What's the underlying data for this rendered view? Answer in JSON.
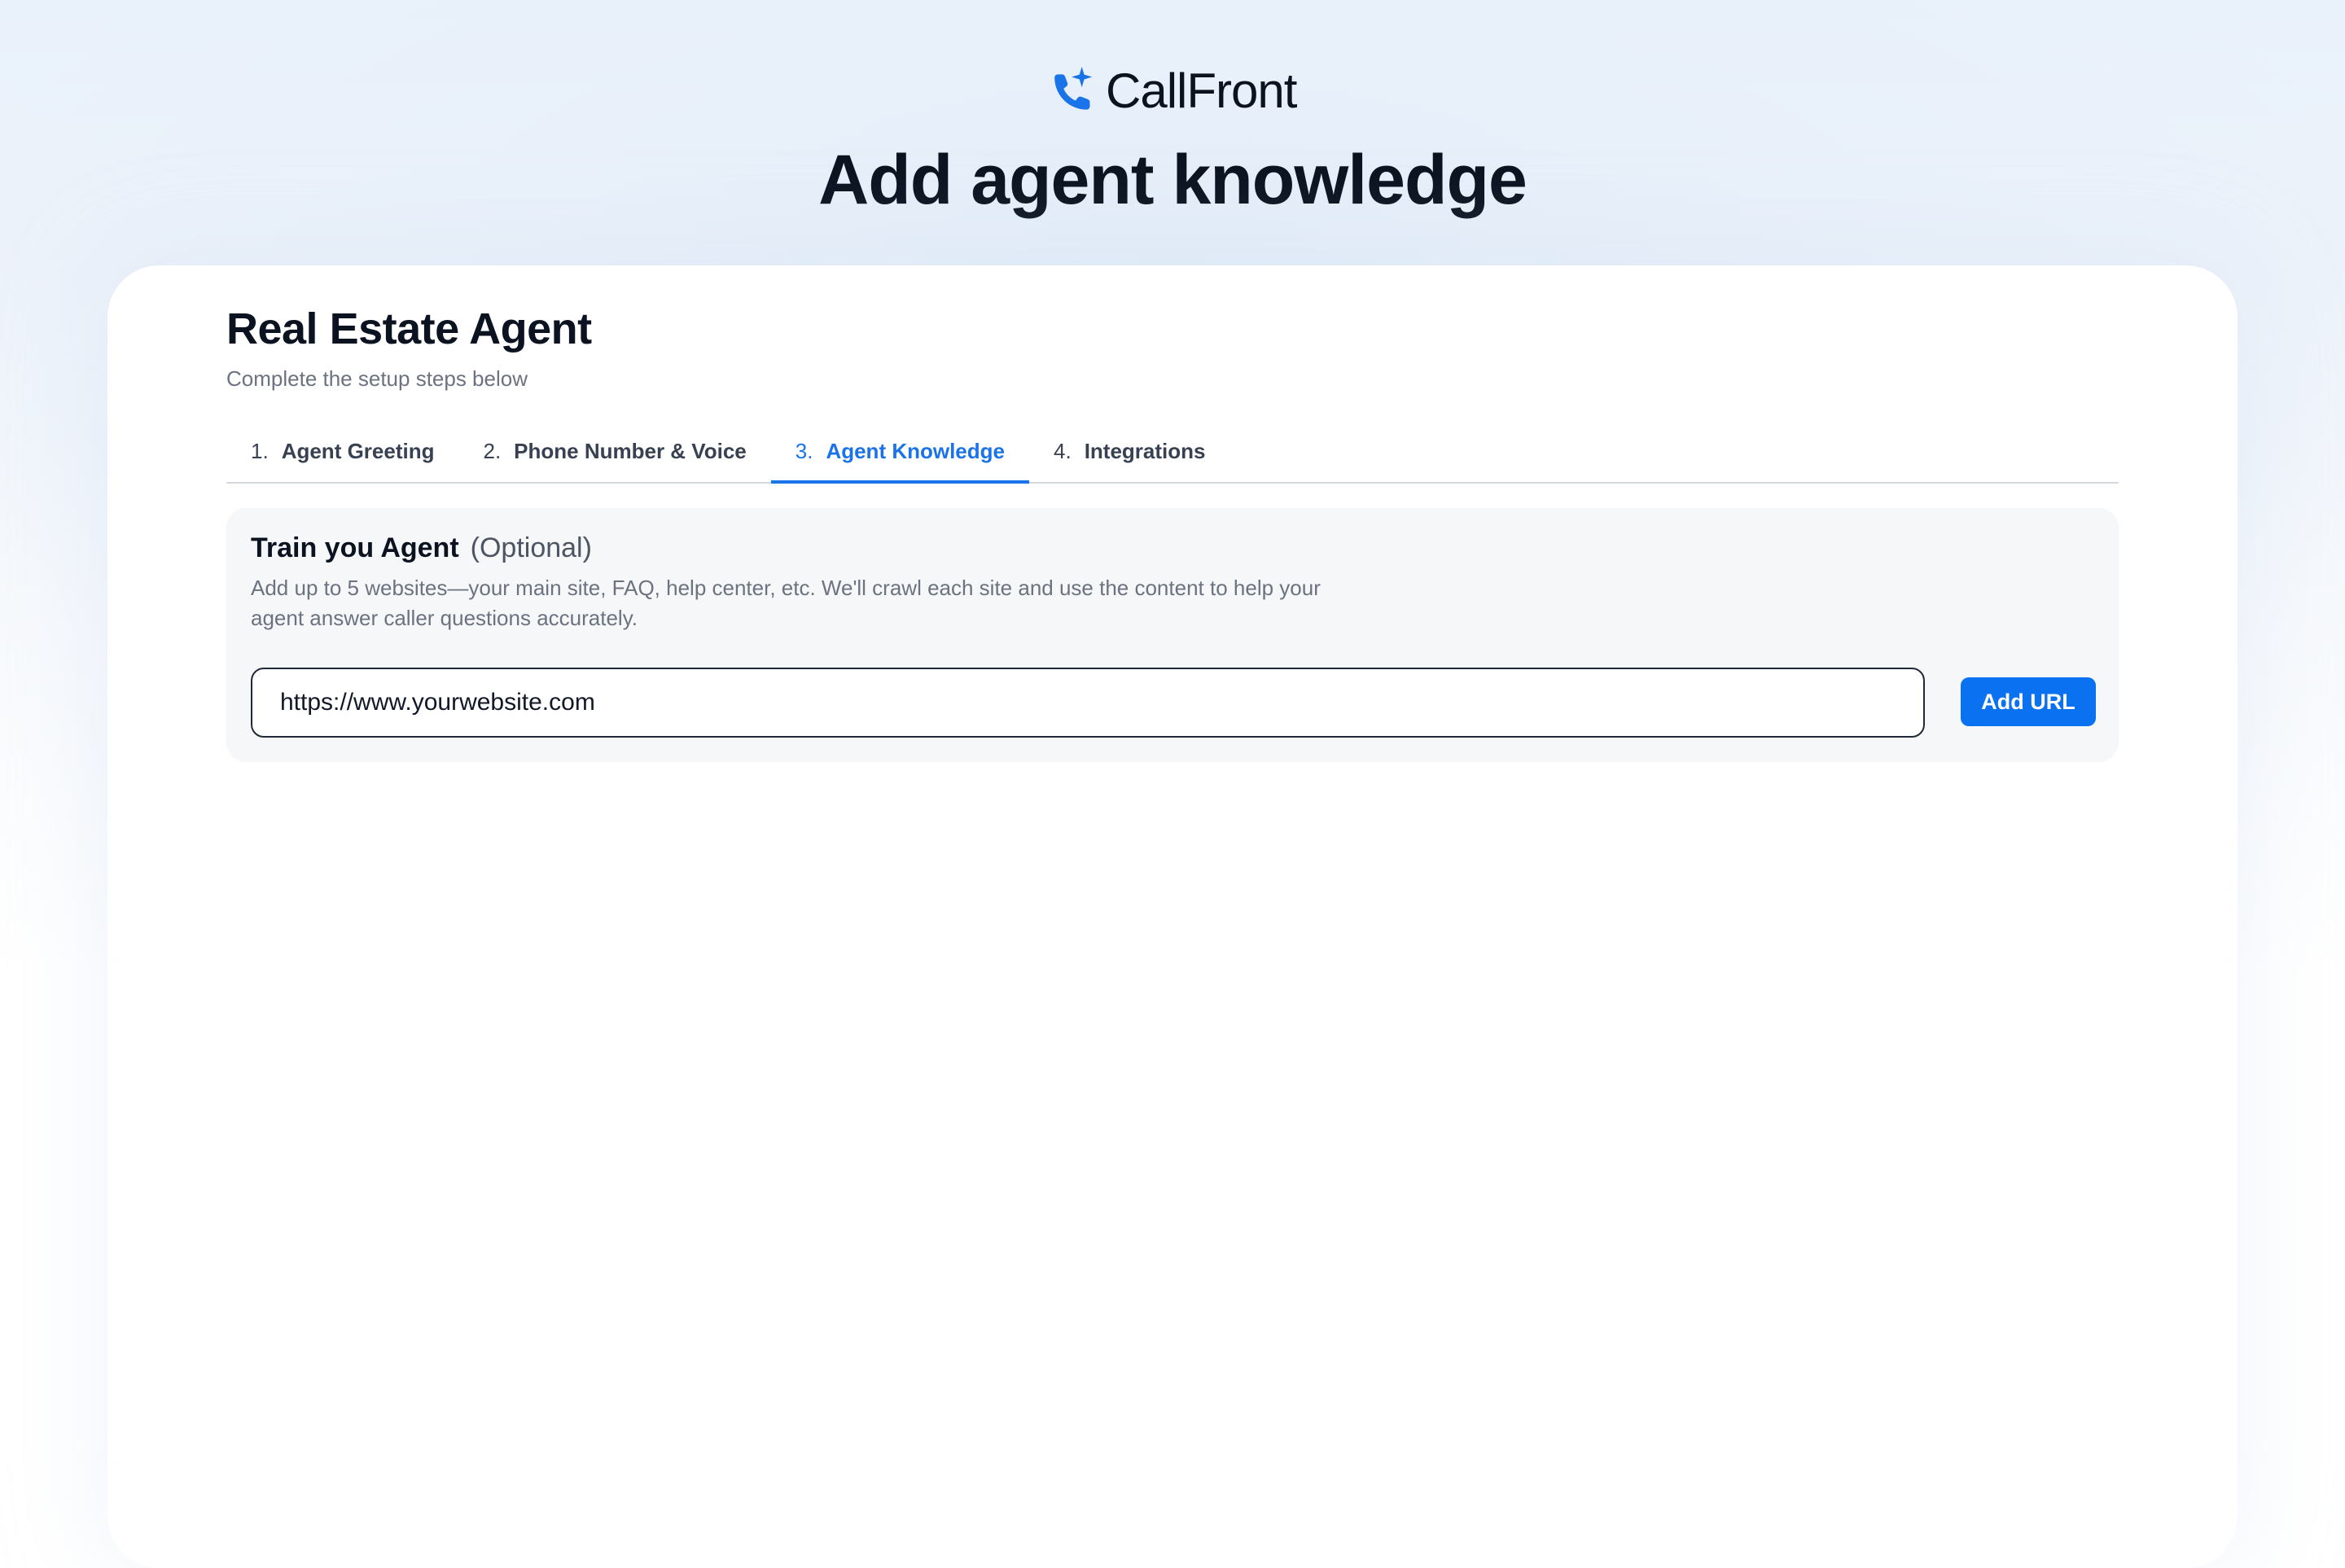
{
  "brand": {
    "name": "CallFront",
    "logo_icon": "phone-sparkle-icon",
    "accent_color": "#1a73e8"
  },
  "page": {
    "title": "Add agent knowledge"
  },
  "agent": {
    "name": "Real Estate Agent",
    "subtitle": "Complete the setup steps below"
  },
  "tabs": [
    {
      "num": "1.",
      "label": "Agent Greeting",
      "active": false
    },
    {
      "num": "2.",
      "label": "Phone Number & Voice",
      "active": false
    },
    {
      "num": "3.",
      "label": "Agent Knowledge",
      "active": true
    },
    {
      "num": "4.",
      "label": "Integrations",
      "active": false
    }
  ],
  "knowledge": {
    "title": "Train you Agent",
    "optional": "(Optional)",
    "description": "Add up to 5 websites—your main site, FAQ, help center, etc. We'll crawl each site and use the content to help your agent answer caller questions accurately.",
    "url_placeholder": "https://www.yourwebsite.com",
    "url_value": "",
    "add_button": "Add URL",
    "button_color": "#0a72f0"
  }
}
